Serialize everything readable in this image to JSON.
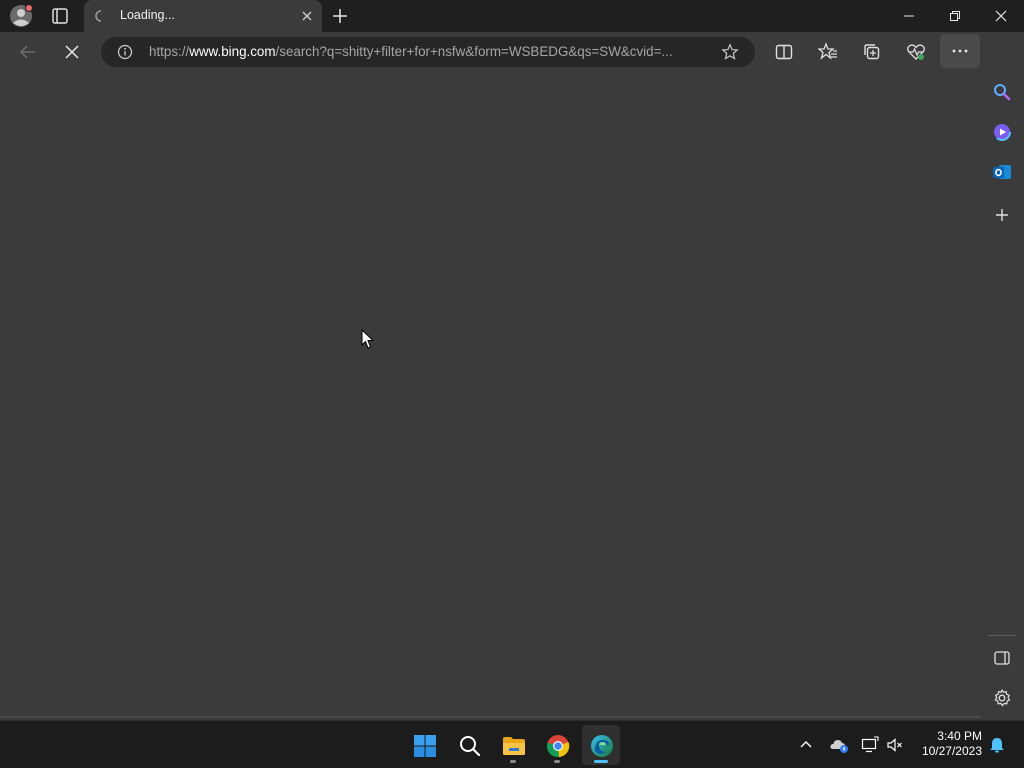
{
  "tab": {
    "title": "Loading..."
  },
  "address_bar": {
    "url_prefix": "https://",
    "url_host": "www.bing.com",
    "url_rest": "/search?q=shitty+filter+for+nsfw&form=WSBEDG&qs=SW&cvid=..."
  },
  "icons": {
    "profile": "profile-avatar-icon",
    "tab_actions": "tab-actions-icon",
    "back": "back-arrow-icon",
    "stop": "stop-loading-icon",
    "favorite": "add-favorite-star-icon",
    "split_screen": "split-screen-icon",
    "favorites": "favorites-icon",
    "collections": "collections-icon",
    "browser_essentials": "browser-essentials-icon",
    "more": "more-options-icon",
    "copilot": "copilot-icon"
  },
  "sidebar": {
    "items": [
      "search-icon",
      "copilot-icon",
      "outlook-icon",
      "add-icon"
    ],
    "bottom": [
      "hide-sidebar-icon",
      "settings-icon"
    ]
  },
  "taskbar": {
    "apps": [
      "start",
      "search",
      "file-explorer",
      "chrome",
      "edge"
    ],
    "clock_time": "3:40 PM",
    "clock_date": "10/27/2023"
  },
  "colors": {
    "page_bg": "#3b3b3b",
    "titlebar_bg": "#1f1f1f",
    "taskbar_bg": "#1c1c1c",
    "accent_blue": "#4cc2ff"
  }
}
